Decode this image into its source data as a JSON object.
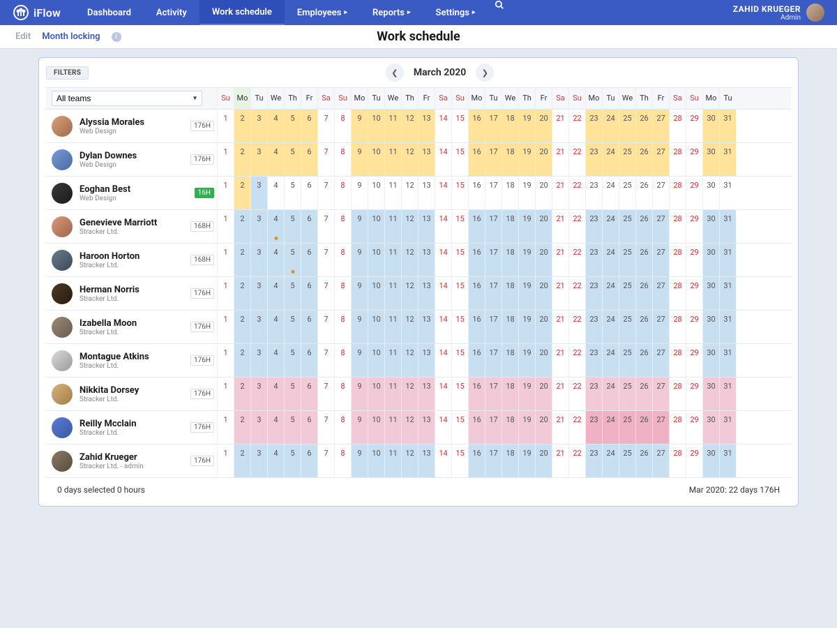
{
  "brand": "iFlow",
  "nav": {
    "dashboard": "Dashboard",
    "activity": "Activity",
    "work_schedule": "Work schedule",
    "employees": "Employees",
    "reports": "Reports",
    "settings": "Settings"
  },
  "user": {
    "name": "ZAHID KRUEGER",
    "role": "Admin"
  },
  "subbar": {
    "edit": "Edit",
    "month_locking": "Month locking"
  },
  "page_title": "Work schedule",
  "filters_label": "FILTERS",
  "team_select": "All teams",
  "month": "March 2020",
  "day_labels": [
    "Su",
    "Mo",
    "Tu",
    "We",
    "Th",
    "Fr",
    "Sa",
    "Su",
    "Mo",
    "Tu",
    "We",
    "Th",
    "Fr",
    "Sa",
    "Su",
    "Mo",
    "Tu",
    "We",
    "Th",
    "Fr",
    "Sa",
    "Su",
    "Mo",
    "Tu",
    "We",
    "Th",
    "Fr",
    "Sa",
    "Su",
    "Mo",
    "Tu"
  ],
  "weekend_idx": [
    0,
    6,
    7,
    13,
    14,
    20,
    21,
    27,
    28
  ],
  "today_idx": 1,
  "employees": [
    {
      "name": "Alyssia Morales",
      "sub": "Web Design",
      "hours": "176H",
      "shade": "yellow",
      "filled": [
        1,
        2,
        3,
        4,
        5,
        8,
        9,
        10,
        11,
        12,
        15,
        16,
        17,
        18,
        19,
        22,
        23,
        24,
        25,
        26,
        29,
        30
      ],
      "dots": []
    },
    {
      "name": "Dylan Downes",
      "sub": "Web Design",
      "hours": "176H",
      "shade": "yellow",
      "filled": [
        1,
        2,
        3,
        4,
        5,
        8,
        9,
        10,
        11,
        12,
        15,
        16,
        17,
        18,
        19,
        22,
        23,
        24,
        25,
        26,
        29,
        30
      ],
      "dots": []
    },
    {
      "name": "Eoghan Best",
      "sub": "Web Design",
      "hours": "16H",
      "shade": "yellow",
      "green": true,
      "filled": [
        1
      ],
      "blue_extra": [
        2
      ],
      "dots": []
    },
    {
      "name": "Genevieve Marriott",
      "sub": "Stracker Ltd.",
      "hours": "168H",
      "shade": "blue",
      "filled": [
        1,
        2,
        3,
        4,
        5,
        8,
        9,
        10,
        11,
        12,
        15,
        16,
        17,
        18,
        19,
        22,
        23,
        24,
        25,
        26,
        29,
        30
      ],
      "dots": [
        3
      ]
    },
    {
      "name": "Haroon Horton",
      "sub": "Stracker Ltd.",
      "hours": "168H",
      "shade": "blue",
      "filled": [
        1,
        2,
        3,
        4,
        5,
        8,
        9,
        10,
        11,
        12,
        15,
        16,
        17,
        18,
        19,
        22,
        23,
        24,
        25,
        26,
        29,
        30
      ],
      "dots": [
        4
      ]
    },
    {
      "name": "Herman Norris",
      "sub": "Stracker Ltd.",
      "hours": "176H",
      "shade": "blue",
      "filled": [
        1,
        2,
        3,
        4,
        5,
        8,
        9,
        10,
        11,
        12,
        15,
        16,
        17,
        18,
        19,
        22,
        23,
        24,
        25,
        26,
        29,
        30
      ],
      "dots": []
    },
    {
      "name": "Izabella Moon",
      "sub": "Stracker Ltd.",
      "hours": "176H",
      "shade": "blue",
      "filled": [
        1,
        2,
        3,
        4,
        5,
        8,
        9,
        10,
        11,
        12,
        15,
        16,
        17,
        18,
        19,
        22,
        23,
        24,
        25,
        26,
        29,
        30
      ],
      "dots": []
    },
    {
      "name": "Montague Atkins",
      "sub": "Stracker Ltd.",
      "hours": "176H",
      "shade": "blue",
      "filled": [
        1,
        2,
        3,
        4,
        5,
        8,
        9,
        10,
        11,
        12,
        15,
        16,
        17,
        18,
        19,
        22,
        23,
        24,
        25,
        26,
        29,
        30
      ],
      "dots": []
    },
    {
      "name": "Nikkita Dorsey",
      "sub": "Stracker Ltd.",
      "hours": "176H",
      "shade": "pink",
      "filled": [
        1,
        2,
        3,
        4,
        5,
        8,
        9,
        10,
        11,
        12,
        15,
        16,
        17,
        18,
        19,
        22,
        23,
        24,
        25,
        26,
        29,
        30
      ],
      "dots": []
    },
    {
      "name": "Reilly Mcclain",
      "sub": "Stracker Ltd.",
      "hours": "176H",
      "shade": "pink",
      "filled": [
        1,
        2,
        3,
        4,
        5,
        8,
        9,
        10,
        11,
        12,
        15,
        16,
        17,
        18,
        19,
        22,
        23,
        24,
        25,
        26,
        29,
        30
      ],
      "darkpink": [
        22,
        23,
        24,
        25,
        26
      ],
      "dots": []
    },
    {
      "name": "Zahid Krueger",
      "sub": "Stracker Ltd. - admin",
      "hours": "176H",
      "shade": "blue",
      "filled": [
        1,
        2,
        3,
        4,
        5,
        8,
        9,
        10,
        11,
        12,
        15,
        16,
        17,
        18,
        19,
        22,
        23,
        24,
        25,
        26,
        29,
        30
      ],
      "dots": []
    }
  ],
  "footer": {
    "left": "0 days selected 0 hours",
    "right": "Mar 2020: 22 days 176H"
  }
}
